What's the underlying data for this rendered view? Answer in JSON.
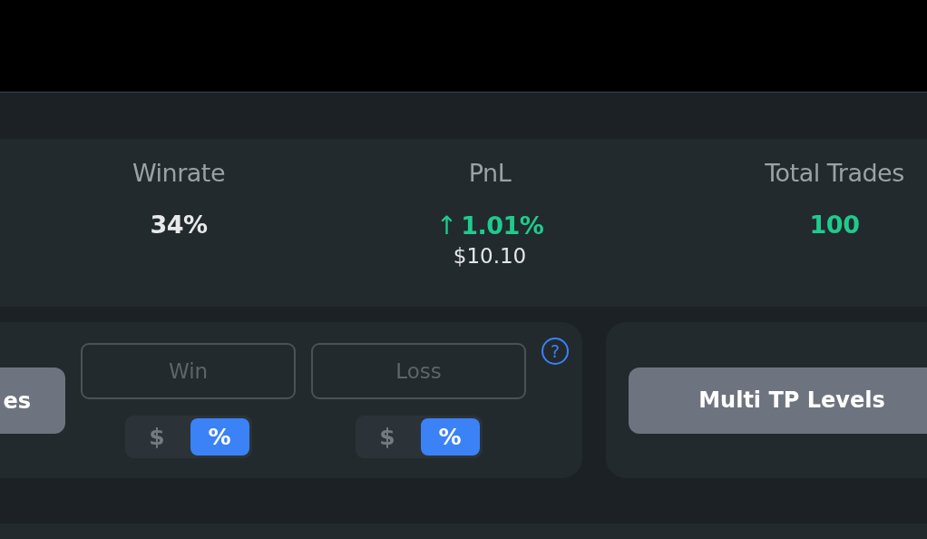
{
  "stats": [
    {
      "label": "Winrate",
      "value": "34%",
      "color": "#e8e9ea"
    },
    {
      "label": "PnL",
      "arrow": "↑",
      "value": "1.01%",
      "color": "#1fcb8c",
      "amount": "$10.10"
    },
    {
      "label": "Total Trades",
      "value": "100",
      "color": "#1fcb8c"
    }
  ],
  "settings_card": {
    "button": "es",
    "fields": [
      {
        "placeholder": "Win",
        "units": [
          {
            "label": "$",
            "selected": false
          },
          {
            "label": "%",
            "selected": true
          }
        ]
      },
      {
        "placeholder": "Loss",
        "units": [
          {
            "label": "$",
            "selected": false
          },
          {
            "label": "%",
            "selected": true
          }
        ]
      }
    ],
    "help": "?"
  },
  "multi_tp_button": "Multi TP Levels"
}
